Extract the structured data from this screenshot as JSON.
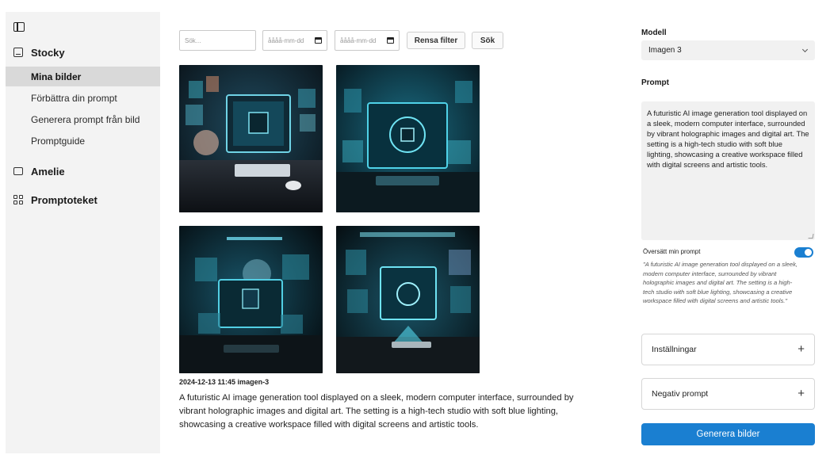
{
  "sidebar": {
    "sections": [
      {
        "label": "Stocky",
        "icon": "image-icon"
      },
      {
        "label": "Amelie",
        "icon": "chat-icon"
      },
      {
        "label": "Promptoteket",
        "icon": "grid-icon"
      }
    ],
    "items": [
      {
        "label": "Mina bilder",
        "active": true
      },
      {
        "label": "Förbättra din prompt",
        "active": false
      },
      {
        "label": "Generera prompt från bild",
        "active": false
      },
      {
        "label": "Promptguide",
        "active": false
      }
    ]
  },
  "filters": {
    "search_placeholder": "Sök...",
    "date_from_placeholder": "åååå-mm-dd",
    "date_to_placeholder": "åååå-mm-dd",
    "clear_label": "Rensa filter",
    "search_label": "Sök"
  },
  "gallery": {
    "meta": "2024-12-13 11:45 imagen-3",
    "prompt": "A futuristic AI image generation tool displayed on a sleek, modern computer interface, surrounded by vibrant holographic images and digital art. The setting is a high-tech studio with soft blue lighting, showcasing a creative workspace filled with digital screens and artistic tools."
  },
  "panel": {
    "model_label": "Modell",
    "model_value": "Imagen 3",
    "prompt_label": "Prompt",
    "prompt_value": "A futuristic AI image generation tool displayed on a sleek, modern computer interface, surrounded by vibrant holographic images and digital art. The setting is a high-tech studio with soft blue lighting, showcasing a creative workspace filled with digital screens and artistic tools.",
    "translate_label": "Översätt min prompt",
    "translate_on": true,
    "translated_text": "\"A futuristic AI image generation tool displayed on a sleek, modern computer interface, surrounded by vibrant holographic images and digital art. The setting is a high-tech studio with soft blue lighting, showcasing a creative workspace filled with digital screens and artistic tools.\"",
    "settings_label": "Inställningar",
    "negative_label": "Negativ prompt",
    "generate_label": "Generera bilder"
  },
  "colors": {
    "accent": "#1a7fd1",
    "sidebar_bg": "#f3f3f3",
    "active_item_bg": "#d9d9d9"
  }
}
